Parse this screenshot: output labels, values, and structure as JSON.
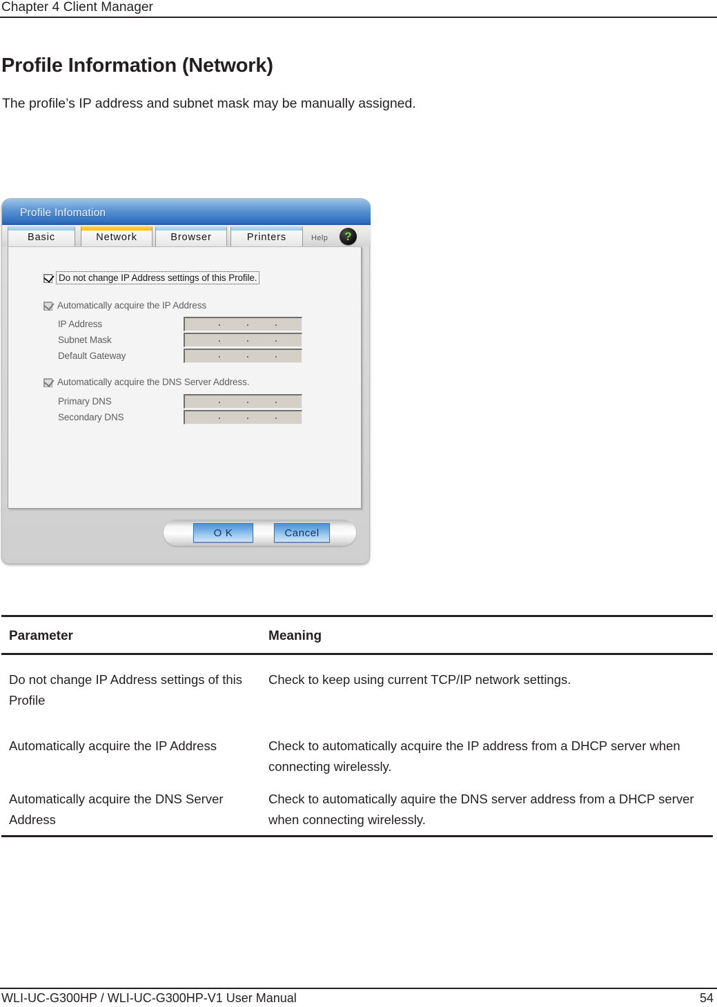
{
  "running_head": {
    "text": "Chapter 4  Client Manager"
  },
  "page": {
    "title": "Profile Information (Network)",
    "intro": "The profile’s IP address and subnet mask may be manually assigned."
  },
  "dialog": {
    "title": "Profile Infomation",
    "tabs": [
      {
        "label": "Basic",
        "active": false
      },
      {
        "label": "Network",
        "active": true
      },
      {
        "label": "Browser",
        "active": false
      },
      {
        "label": "Printers",
        "active": false
      }
    ],
    "help": {
      "label": "Help",
      "icon": "question-mark-icon",
      "glyph": "?"
    },
    "checkboxes": [
      {
        "label": "Do not change IP Address settings of this Profile.",
        "checked": true,
        "enabled": true,
        "focused": true
      },
      {
        "label": "Automatically acquire the IP Address",
        "checked": true,
        "enabled": false,
        "focused": false
      },
      {
        "label": "Automatically acquire the DNS Server Address.",
        "checked": true,
        "enabled": false,
        "focused": false
      }
    ],
    "ip_fields": [
      {
        "label": "IP Address",
        "value": "",
        "enabled": false
      },
      {
        "label": "Subnet Mask",
        "value": "",
        "enabled": false
      },
      {
        "label": "Default Gateway",
        "value": "",
        "enabled": false
      }
    ],
    "dns_fields": [
      {
        "label": "Primary DNS",
        "value": "",
        "enabled": false
      },
      {
        "label": "Secondary DNS",
        "value": "",
        "enabled": false
      }
    ],
    "buttons": {
      "ok": "O K",
      "cancel": "Cancel"
    },
    "colors": {
      "titlebar_blue": "#2f6fc0",
      "active_tab_orange": "#fcb913",
      "inactive_tab_blue": "#9cc8ee",
      "help_green": "#78d92a",
      "button_blue": "#69a8e2",
      "field_bg": "#d4d0c8"
    }
  },
  "table": {
    "headers": [
      "Parameter",
      "Meaning"
    ],
    "rows": [
      {
        "parameter": "Do not change IP Address settings of this Profile",
        "meaning": "Check to keep using current TCP/IP network settings."
      },
      {
        "parameter": "Automatically acquire the IP Address",
        "meaning": "Check to automatically acquire the IP address from a DHCP server when connecting wirelessly."
      },
      {
        "parameter": "Automatically acquire the DNS Server Address",
        "meaning": "Check to automatically aquire the DNS server address from a DHCP server when connecting wirelessly."
      }
    ]
  },
  "footer": {
    "left": "WLI-UC-G300HP / WLI-UC-G300HP-V1 User Manual",
    "page_number": "54"
  }
}
